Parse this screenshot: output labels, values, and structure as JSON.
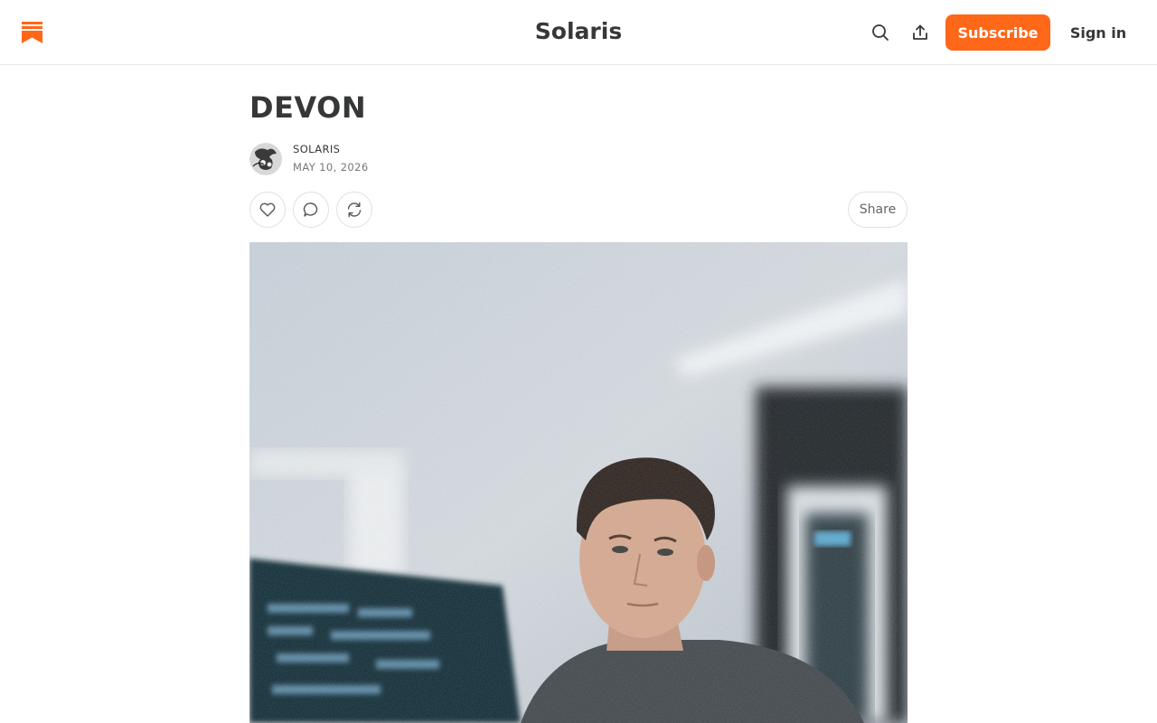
{
  "header": {
    "publication_name": "Solaris",
    "subscribe_label": "Subscribe",
    "signin_label": "Sign in",
    "logo_icon": "substack-logo-icon",
    "search_icon": "search-icon",
    "share_icon": "share-upload-icon"
  },
  "post": {
    "title": "DEVON",
    "author": "SOLARIS",
    "date": "MAY 10, 2026",
    "share_label": "Share",
    "like_icon": "heart-icon",
    "comment_icon": "comment-icon",
    "restack_icon": "restack-icon",
    "hero_image": "photo-man-at-computer"
  },
  "colors": {
    "accent": "#ff6719",
    "text": "#363737",
    "muted": "#777777",
    "border": "#e6e6e6"
  }
}
